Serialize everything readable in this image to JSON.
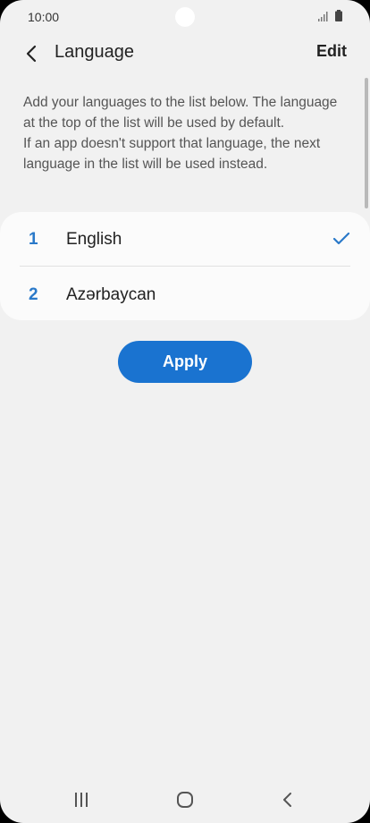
{
  "status_bar": {
    "time": "10:00",
    "icons": [
      "signal-icon",
      "battery-icon"
    ]
  },
  "header": {
    "back_icon": "back-arrow-icon",
    "title": "Language",
    "edit_label": "Edit"
  },
  "description": {
    "line1": "Add your languages to the list below. The language at the top of the list will be used by default.",
    "line2": "If an app doesn't support that language, the next language in the list will be used instead."
  },
  "languages": [
    {
      "number": "1",
      "name": "English",
      "selected": true
    },
    {
      "number": "2",
      "name": "Azərbaycan",
      "selected": false
    }
  ],
  "apply_label": "Apply",
  "colors": {
    "accent": "#1a73d0",
    "number": "#2a79c9",
    "background": "#f1f1f1",
    "card": "#fbfbfb"
  },
  "nav_bar": {
    "icons": [
      "recents-icon",
      "home-icon",
      "back-icon"
    ]
  }
}
